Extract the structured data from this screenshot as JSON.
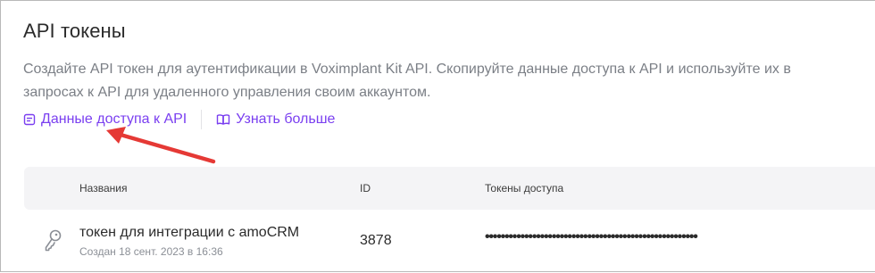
{
  "header": {
    "title": "API токены",
    "description": "Создайте API токен для аутентификации в Voximplant Kit API. Скопируйте данные доступа к API и используйте их в запросах к API для удаленного управления своим аккаунтом."
  },
  "links": {
    "access_data": "Данные доступа к API",
    "learn_more": "Узнать больше"
  },
  "table": {
    "columns": [
      "Названия",
      "ID",
      "Токены доступа"
    ],
    "rows": [
      {
        "name": "токен для интеграции с amoCRM",
        "created": "Создан 18 сент. 2023 в 16:36",
        "id": "3878",
        "token": "••••••••••••••••••••••••••••••••••••••••••••••••••••••"
      }
    ]
  },
  "colors": {
    "accent": "#7a3ff0",
    "annotation_arrow": "#e53935",
    "header_bg": "#f4f4f6"
  }
}
